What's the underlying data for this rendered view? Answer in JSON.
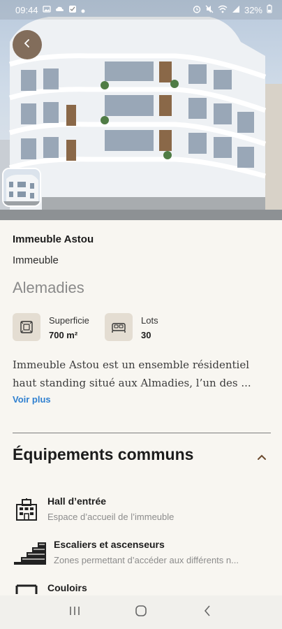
{
  "status_bar": {
    "time": "09:44",
    "battery": "32%",
    "icons_left": [
      "image-icon",
      "cloud-icon",
      "check-icon",
      "dot-icon"
    ],
    "icons_right": [
      "alarm-icon",
      "mute-icon",
      "wifi-icon",
      "signal-icon",
      "battery-icon"
    ]
  },
  "property": {
    "name": "Immeuble Astou",
    "type": "Immeuble",
    "location": "Alemadies",
    "stats": [
      {
        "label": "Superficie",
        "value": "700 m²",
        "icon": "area-icon"
      },
      {
        "label": "Lots",
        "value": "30",
        "icon": "bed-icon"
      }
    ],
    "description_line1": "Immeuble Astou est un ensemble résidentiel",
    "description_line2": "haut standing situé aux Almadies, l’un des ...",
    "see_more": "Voir plus"
  },
  "amenities": {
    "title": "Équipements communs",
    "items": [
      {
        "name": "Hall d’entrée",
        "description": "Espace d’accueil de l’immeuble",
        "icon": "building-icon"
      },
      {
        "name": "Escaliers et ascenseurs",
        "description": "Zones permettant d’accéder aux différents n...",
        "icon": "stairs-icon"
      },
      {
        "name": "Couloirs",
        "description": "",
        "icon": "corridor-icon"
      }
    ]
  },
  "colors": {
    "background": "#f8f6f1",
    "accent_link": "#2f80d0",
    "back_button": "#6e5640",
    "icon_tile": "#e4ddd2"
  }
}
